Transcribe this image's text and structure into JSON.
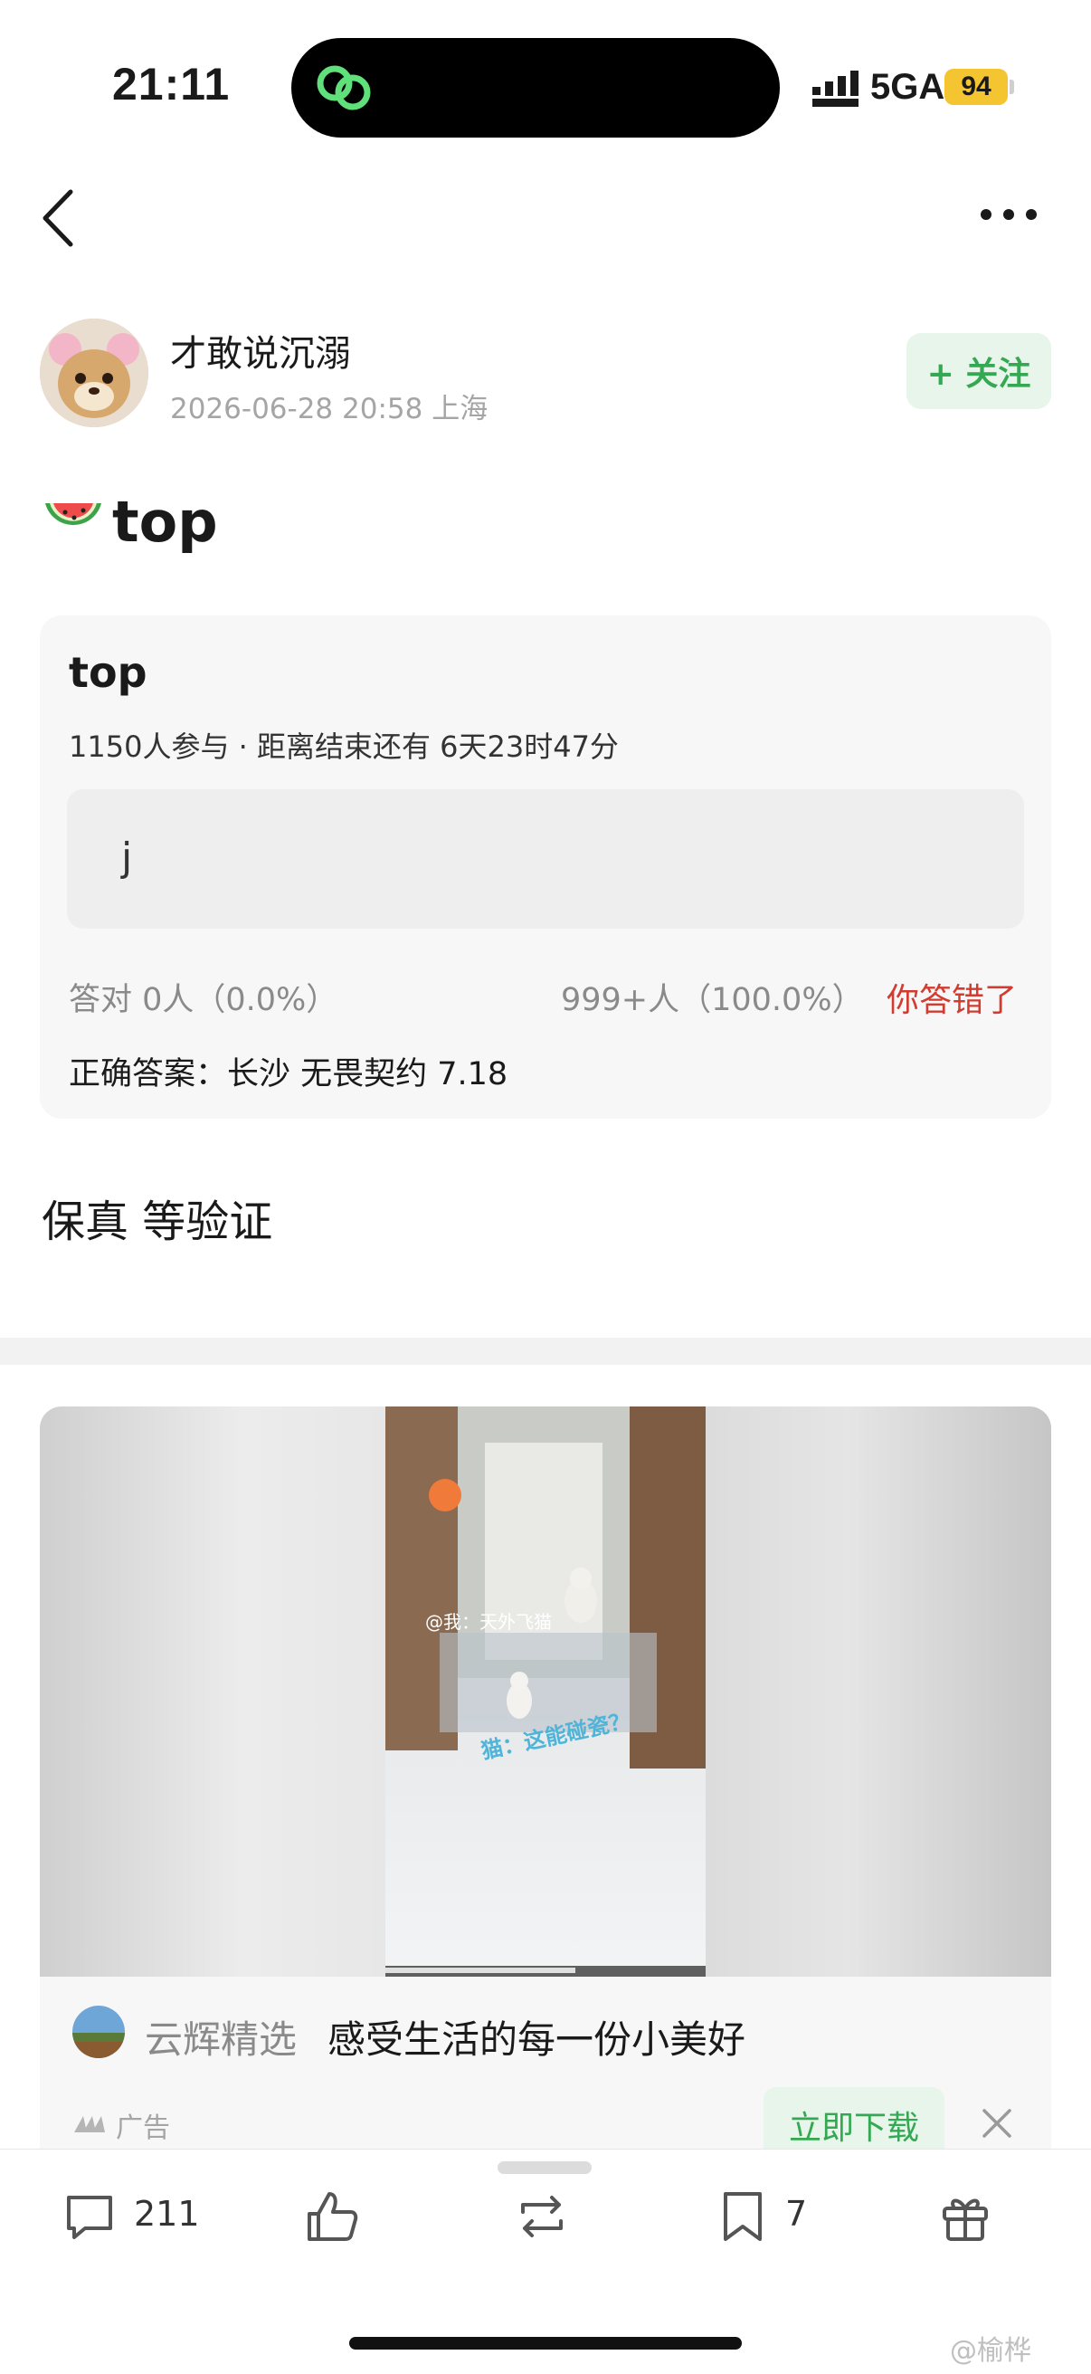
{
  "status_bar": {
    "time": "21:11",
    "network": "5GA",
    "battery": "94"
  },
  "post": {
    "author": "才敢说沉溺",
    "meta": "2026-06-28 20:58  上海",
    "follow_label": "+ 关注",
    "title": "top",
    "title_emoji": "🍉",
    "quiz": {
      "title": "top",
      "meta": "1150人参与 · 距离结束还有 6天23时47分",
      "option": "j",
      "stat_correct": "答对  0人（0.0%）",
      "stat_wrong": "999+人（100.0%）",
      "result": "你答错了",
      "answer": "正确答案：长沙 无畏契约 7.18"
    },
    "body": "保真 等验证"
  },
  "ad": {
    "video_text_1": "@我：天外飞猫",
    "video_text_2": "猫：这能碰瓷？",
    "brand": "云辉精选",
    "slogan": "感受生活的每一份小美好",
    "badge": "广告",
    "download_label": "立即下载"
  },
  "bottom_bar": {
    "comments": "211",
    "bookmarks": "7"
  },
  "watermark": "@榆桦",
  "colors": {
    "accent_green": "#35a853",
    "error_red": "#d23b2f"
  }
}
